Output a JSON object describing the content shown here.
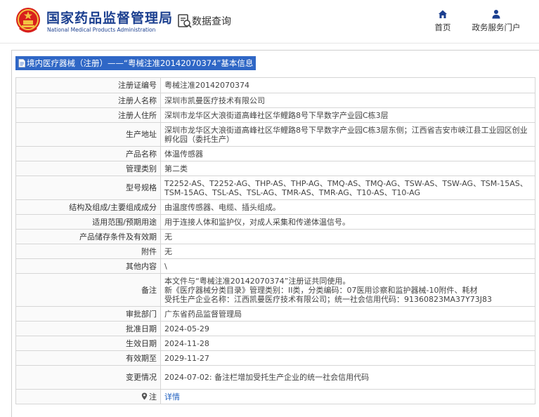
{
  "header": {
    "brand_cn": "国家药品监督管理局",
    "brand_en": "National Medical Products Administration",
    "query_label": "数据查询",
    "nav": {
      "home": "首页",
      "gov_service": "政务服务门户"
    }
  },
  "title": "境内医疗器械（注册）——“粤械注准20142070374”基本信息",
  "rows": [
    {
      "label": "注册证编号",
      "value": "粤械注准20142070374"
    },
    {
      "label": "注册人名称",
      "value": "深圳市凯曼医疗技术有限公司"
    },
    {
      "label": "注册人住所",
      "value": "深圳市龙华区大浪街道高峰社区华鲤路8号下早数字产业园C栋3层"
    },
    {
      "label": "生产地址",
      "value": "深圳市龙华区大浪街道高峰社区华鲤路8号下早数字产业园C栋3层东侧；江西省吉安市峡江县工业园区创业孵化园（委托生产）"
    },
    {
      "label": "产品名称",
      "value": "体温传感器"
    },
    {
      "label": "管理类别",
      "value": "第二类"
    },
    {
      "label": "型号规格",
      "value": "T2252-AS、T2252-AG、THP-AS、THP-AG、TMQ-AS、TMQ-AG、TSW-AS、TSW-AG、TSM-15AS、TSM-15AG、TSL-AS、TSL-AG、TMR-AS、TMR-AG、T10-AS、T10-AG"
    },
    {
      "label": "结构及组成/主要组成成分",
      "value": "由温度传感器、电缆、插头组成。"
    },
    {
      "label": "适用范围/预期用途",
      "value": "用于连接人体和监护仪，对成人采集和传递体温信号。"
    },
    {
      "label": "产品储存条件及有效期",
      "value": "无"
    },
    {
      "label": "附件",
      "value": "无"
    },
    {
      "label": "其他内容",
      "value": "\\"
    },
    {
      "label": "备注",
      "value": [
        "本文件与“粤械注准20142070374”注册证共同使用。",
        "新《医疗器械分类目录》管理类别：II类，分类编码：07医用诊察和监护器械-10附件、耗材",
        "受托生产企业名称：江西凯曼医疗技术有限公司；统一社会信用代码：91360823MA37Y73J83"
      ]
    },
    {
      "label": "审批部门",
      "value": "广东省药品监督管理局"
    },
    {
      "label": "批准日期",
      "value": "2024-05-29"
    },
    {
      "label": "生效日期",
      "value": "2024-11-28"
    },
    {
      "label": "有效期至",
      "value": "2029-11-27"
    },
    {
      "label": "变更情况",
      "value": "2024-07-02: 备注栏增加受托生产企业的统一社会信用代码"
    }
  ],
  "note_row": {
    "label": "注",
    "link": "详情"
  }
}
